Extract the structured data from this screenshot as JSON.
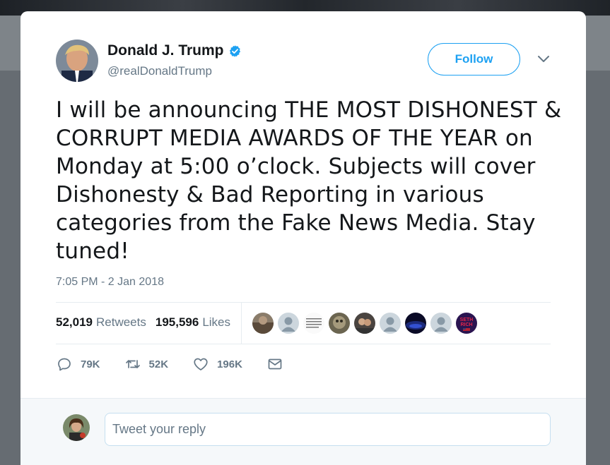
{
  "author": {
    "name": "Donald J. Trump",
    "handle": "@realDonaldTrump",
    "verified": true
  },
  "follow_button": {
    "label": "Follow"
  },
  "tweet": {
    "text": "I will be announcing THE MOST DISHONEST & CORRUPT MEDIA AWARDS OF THE YEAR on Monday at 5:00 o’clock. Subjects will cover Dishonesty & Bad Reporting in various categories from the Fake News Media. Stay tuned!",
    "timestamp": "7:05 PM - 2 Jan 2018"
  },
  "stats": {
    "retweets_count": "52,019",
    "retweets_label": "Retweets",
    "likes_count": "195,596",
    "likes_label": "Likes"
  },
  "likers": {
    "avatars": [
      "liker-avatar",
      "liker-avatar",
      "liker-avatar",
      "liker-avatar",
      "liker-avatar",
      "liker-avatar",
      "liker-avatar",
      "liker-avatar",
      "liker-avatar"
    ],
    "badge_text_top": "SETH",
    "badge_text_bottom": "RICH"
  },
  "actions": {
    "reply_count": "79K",
    "retweet_count": "52K",
    "like_count": "196K"
  },
  "reply": {
    "placeholder": "Tweet your reply"
  },
  "colors": {
    "accent": "#1da1f2",
    "text": "#14171a",
    "secondary": "#657786",
    "divider": "#e6ecf0"
  }
}
